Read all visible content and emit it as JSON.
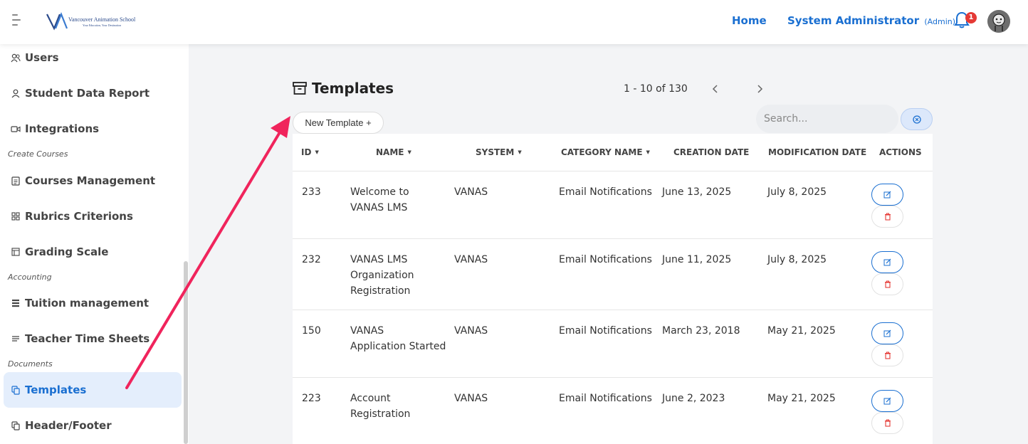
{
  "header": {
    "logo_text": "Vancouver Animation School",
    "logo_tagline": "Your Education, Your Destination",
    "home_label": "Home",
    "user_name": "System Administrator",
    "user_role": "(Admin)",
    "notification_count": "1",
    "accent_color": "#1a6fd1"
  },
  "sidebar": {
    "items": [
      {
        "label": "Users",
        "icon": "users-icon"
      },
      {
        "label": "Student Data Report",
        "icon": "user-icon"
      },
      {
        "label": "Integrations",
        "icon": "video-icon"
      },
      {
        "label": "Courses Management",
        "icon": "clipboard-icon"
      },
      {
        "label": "Rubrics Criterions",
        "icon": "grid-icon"
      },
      {
        "label": "Grading Scale",
        "icon": "table-icon"
      },
      {
        "label": "Tuition management",
        "icon": "list-icon"
      },
      {
        "label": "Teacher Time Sheets",
        "icon": "lines-icon"
      },
      {
        "label": "Templates",
        "icon": "copy-icon",
        "active": true
      },
      {
        "label": "Header/Footer",
        "icon": "copy-icon"
      }
    ],
    "sections": [
      "Create Courses",
      "Accounting",
      "Documents"
    ]
  },
  "main": {
    "title": "Templates",
    "pagination": "1 - 10 of 130",
    "prev_label": "‹",
    "next_label": "›",
    "new_button_label": "New Template +",
    "search_placeholder": "Search..."
  },
  "table": {
    "columns": [
      "ID",
      "NAME",
      "SYSTEM",
      "CATEGORY NAME",
      "CREATION DATE",
      "MODIFICATION DATE",
      "ACTIONS"
    ],
    "rows": [
      {
        "id": "233",
        "name_lines": [
          "Welcome to",
          "VANAS LMS"
        ],
        "system": "VANAS",
        "category": "Email Notifications",
        "created": "June 13, 2025",
        "modified": "July 8, 2025"
      },
      {
        "id": "232",
        "name_lines": [
          "VANAS LMS",
          "Organization",
          "Registration"
        ],
        "system": "VANAS",
        "category": "Email Notifications",
        "created": "June 11, 2025",
        "modified": "July 8, 2025"
      },
      {
        "id": "150",
        "name_lines": [
          "VANAS",
          "Application Started"
        ],
        "system": "VANAS",
        "category": "Email Notifications",
        "created": "March 23, 2018",
        "modified": "May 21, 2025"
      },
      {
        "id": "223",
        "name_lines": [
          "Account",
          "Registration"
        ],
        "system": "VANAS",
        "category": "Email Notifications",
        "created": "June 2, 2023",
        "modified": "May 21, 2025"
      }
    ]
  },
  "annotation": {
    "arrow_color": "#f0245c"
  }
}
